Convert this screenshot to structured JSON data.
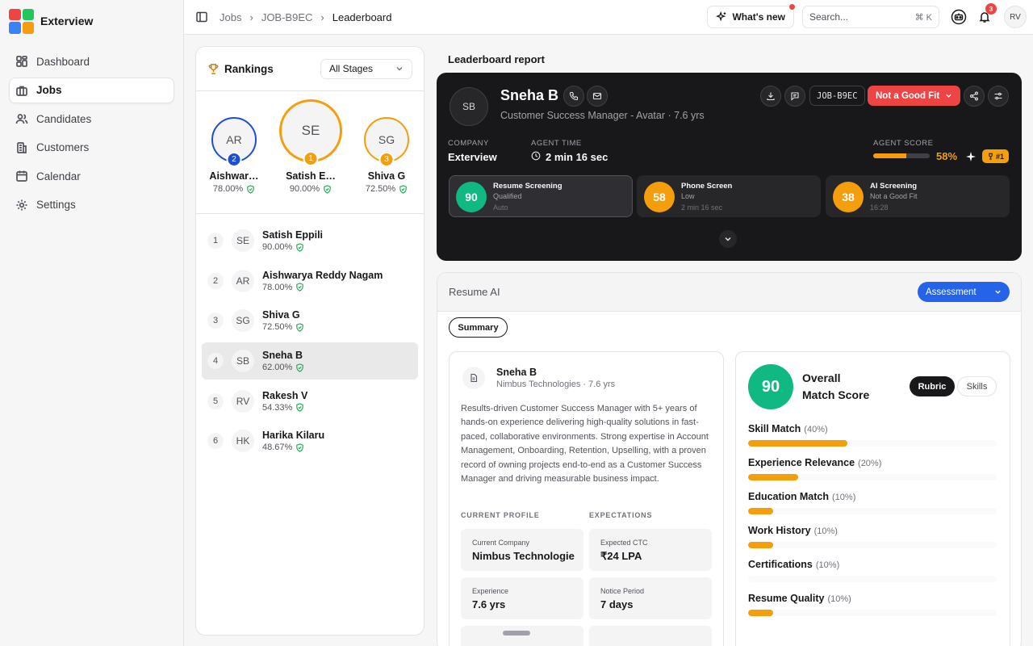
{
  "app": {
    "name": "Exterview",
    "logo_colors": [
      "#ef4444",
      "#22c55e",
      "#3b82f6",
      "#f59e0b"
    ]
  },
  "sidebar": {
    "items": [
      {
        "label": "Dashboard",
        "icon": "dashboard-icon"
      },
      {
        "label": "Jobs",
        "icon": "briefcase-icon",
        "active": true
      },
      {
        "label": "Candidates",
        "icon": "users-icon"
      },
      {
        "label": "Customers",
        "icon": "building-icon"
      },
      {
        "label": "Calendar",
        "icon": "calendar-icon"
      },
      {
        "label": "Settings",
        "icon": "gear-icon"
      }
    ]
  },
  "topbar": {
    "breadcrumb": [
      "Jobs",
      "JOB-B9EC",
      "Leaderboard"
    ],
    "whats_new": "What's new",
    "search_placeholder": "Search...",
    "search_shortcut": "⌘ K",
    "notification_count": "3",
    "user_initials": "RV"
  },
  "rankings": {
    "title": "Rankings",
    "stage_filter": "All Stages",
    "podium": [
      {
        "initials": "AR",
        "rank": "2",
        "name": "Aishwar…",
        "score": "78.00%"
      },
      {
        "initials": "SE",
        "rank": "1",
        "name": "Satish E…",
        "score": "90.00%"
      },
      {
        "initials": "SG",
        "rank": "3",
        "name": "Shiva G",
        "score": "72.50%"
      }
    ],
    "list": [
      {
        "rank": "1",
        "initials": "SE",
        "name": "Satish Eppili",
        "score": "90.00%"
      },
      {
        "rank": "2",
        "initials": "AR",
        "name": "Aishwarya Reddy Nagam",
        "score": "78.00%"
      },
      {
        "rank": "3",
        "initials": "SG",
        "name": "Shiva G",
        "score": "72.50%"
      },
      {
        "rank": "4",
        "initials": "SB",
        "name": "Sneha B",
        "score": "62.00%",
        "selected": true
      },
      {
        "rank": "5",
        "initials": "RV",
        "name": "Rakesh V",
        "score": "54.33%"
      },
      {
        "rank": "6",
        "initials": "HK",
        "name": "Harika Kilaru",
        "score": "48.67%"
      }
    ]
  },
  "report": {
    "title": "Leaderboard report",
    "candidate": {
      "initials": "SB",
      "name": "Sneha B",
      "subtitle": "Customer Success Manager - Avatar · 7.6 yrs",
      "job_id": "JOB-B9EC",
      "status": "Not a Good Fit",
      "company_label": "COMPANY",
      "company": "Exterview",
      "agent_time_label": "AGENT TIME",
      "agent_time": "2 min 16 sec",
      "agent_score_label": "AGENT SCORE",
      "agent_score": "58%",
      "agent_score_fraction": 0.58,
      "rank_chip": "#1"
    },
    "stages": [
      {
        "score": "90",
        "title": "Resume Screening",
        "line1": "Qualified",
        "line2": "Auto",
        "color": "#10b981"
      },
      {
        "score": "58",
        "title": "Phone Screen",
        "line1": "Low",
        "line2": "2 min 16 sec",
        "color": "#f59e0b"
      },
      {
        "score": "38",
        "title": "AI Screening",
        "line1": "Not a Good Fit",
        "line2": "16:28",
        "color": "#f59e0b"
      }
    ]
  },
  "resume_ai": {
    "title": "Resume AI",
    "mode": "Assessment",
    "tab": "Summary",
    "cv": {
      "name": "Sneha B",
      "subtitle": "Nimbus Technologies · 7.6 yrs",
      "summary": "Results-driven Customer Success Manager with 5+ years of hands-on experience delivering high-quality solutions in fast-paced, collaborative environments. Strong expertise in Account Management, Onboarding, Retention, Upselling, with a proven record of owning projects end-to-end as a Customer Success Manager and driving measurable business impact.",
      "current_profile_label": "CURRENT PROFILE",
      "expectations_label": "EXPECTATIONS",
      "current_company_label": "Current Company",
      "current_company": "Nimbus Technologie",
      "expected_ctc_label": "Expected CTC",
      "expected_ctc": "₹24 LPA",
      "experience_label": "Experience",
      "experience": "7.6 yrs",
      "notice_label": "Notice Period",
      "notice": "7 days"
    },
    "match": {
      "score": "90",
      "title": "Overall Match Score",
      "tab_rubric": "Rubric",
      "tab_skills": "Skills",
      "criteria": [
        {
          "name": "Skill Match",
          "weight": "(40%)",
          "fill": 0.4
        },
        {
          "name": "Experience Relevance",
          "weight": "(20%)",
          "fill": 0.2
        },
        {
          "name": "Education Match",
          "weight": "(10%)",
          "fill": 0.1
        },
        {
          "name": "Work History",
          "weight": "(10%)",
          "fill": 0.1
        },
        {
          "name": "Certifications",
          "weight": "(10%)",
          "fill": 0
        },
        {
          "name": "Resume Quality",
          "weight": "(10%)",
          "fill": 0.1
        }
      ]
    }
  }
}
